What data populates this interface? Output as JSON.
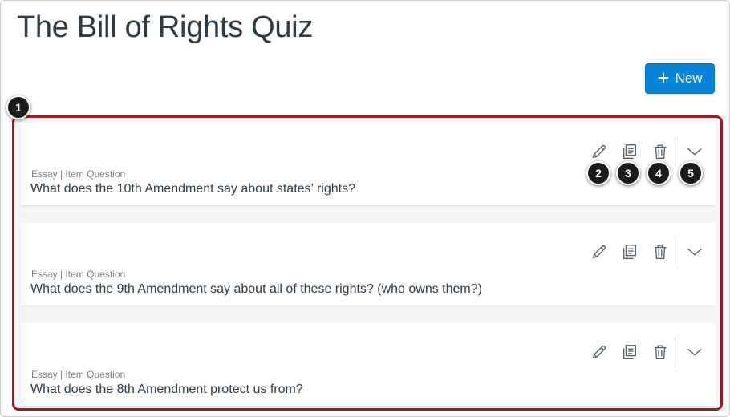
{
  "page_title": "The Bill of Rights Quiz",
  "new_button": {
    "icon": "plus-icon",
    "label": "New"
  },
  "items": [
    {
      "type": "Essay | Item Question",
      "text": "What does the 10th Amendment say about states’ rights?"
    },
    {
      "type": "Essay | Item Question",
      "text": "What does the 9th Amendment say about all of these rights? (who owns them?)"
    },
    {
      "type": "Essay | Item Question",
      "text": "What does the 8th Amendment protect us from?"
    }
  ],
  "action_icons": [
    "pencil-icon",
    "copy-icon",
    "trash-icon",
    "chevron-down-icon"
  ],
  "callouts": [
    "1",
    "2",
    "3",
    "4",
    "5"
  ],
  "colors": {
    "primary": "#0a84d6",
    "highlight": "#a31622",
    "callout": "#1b1b1b"
  }
}
